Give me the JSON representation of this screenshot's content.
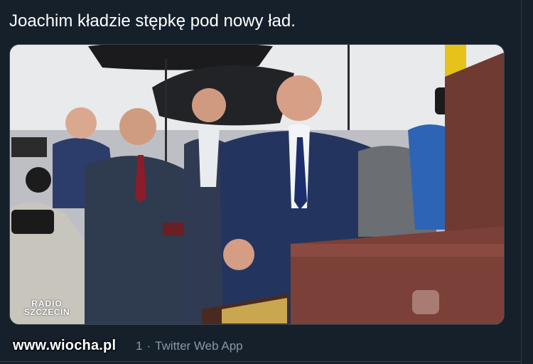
{
  "tweet": {
    "text": "Joachim kładzie stępkę pod nowy ład.",
    "date_fragment": "1",
    "separator": "·",
    "source": "Twitter Web App"
  },
  "photo": {
    "alt_logo_line1": "RADIO",
    "alt_logo_line2": "SZCZECIN"
  },
  "watermark": "www.wiocha.pl",
  "colors": {
    "background": "#15202b",
    "text": "#ffffff",
    "muted": "#8899a6"
  }
}
